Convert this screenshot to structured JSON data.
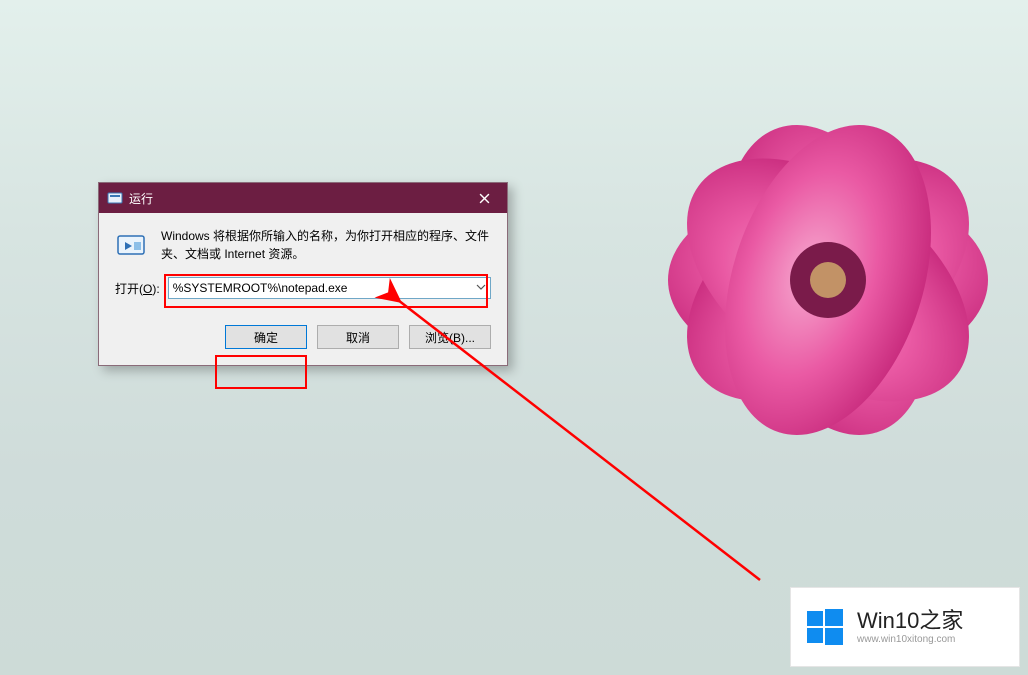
{
  "dialog": {
    "title": "运行",
    "message": "Windows 将根据你所输入的名称，为你打开相应的程序、文件夹、文档或 Internet 资源。",
    "open_label_prefix": "打开(",
    "open_label_accel": "O",
    "open_label_suffix": "):",
    "input_value": "%SYSTEMROOT%\\notepad.exe",
    "buttons": {
      "ok": "确定",
      "cancel": "取消",
      "browse": "浏览(B)..."
    }
  },
  "watermark": {
    "title": "Win10之家",
    "url": "www.win10xitong.com"
  },
  "colors": {
    "titlebar": "#6c1e42",
    "highlight": "#ff0000",
    "logo": "#0f8cf0",
    "flower": "#e84a9c"
  }
}
